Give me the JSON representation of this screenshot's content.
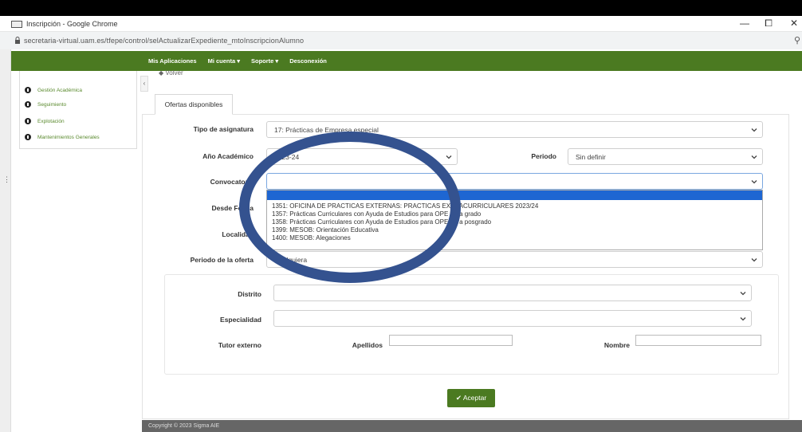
{
  "window": {
    "title": "Inscripción - Google Chrome",
    "controls": [
      "—",
      "⧠",
      "✕"
    ]
  },
  "browser": {
    "url": "secretaria-virtual.uam.es/tfepe/control/selActualizarExpediente_mtoInscripcionAlumno"
  },
  "navbar": {
    "items": [
      "Mis Aplicaciones",
      "Mi cuenta ▾",
      "Soporte ▾",
      "Desconexión"
    ]
  },
  "sidebar": {
    "items": [
      "Gestión Académica",
      "Seguimiento",
      "Explotación",
      "Mantenimientos Generales"
    ]
  },
  "page": {
    "volver": "Volver",
    "tab": "Ofertas disponibles"
  },
  "form": {
    "tipo_asignatura": {
      "label": "Tipo de asignatura",
      "value": "17: Prácticas de Empresa especial"
    },
    "anio": {
      "label": "Año Académico",
      "value": "2023-24"
    },
    "periodo": {
      "label": "Periodo",
      "value": "Sin definir"
    },
    "convocatoria": {
      "label": "Convocatoria",
      "value": ""
    },
    "desde_fecha": {
      "label": "Desde Fecha"
    },
    "localidad": {
      "label": "Localidad"
    },
    "periodo_oferta": {
      "label": "Periodo de la oferta",
      "value": "Cualquiera"
    },
    "distrito": {
      "label": "Distrito",
      "value": ""
    },
    "especialidad": {
      "label": "Especialidad",
      "value": ""
    },
    "tutor": {
      "label": "Tutor externo",
      "apellidos": "Apellidos",
      "nombre": "Nombre"
    }
  },
  "dropdown_options": [
    "1351: OFICINA DE PRACTICAS EXTERNAS: PRACTICAS EXTRACURRICULARES 2023/24",
    "1357: Prácticas Curriculares con Ayuda de Estudios para OPE para grado",
    "1358: Prácticas Curriculares con Ayuda de Estudios para OPE para posgrado",
    "1399: MESOB: Orientación Educativa",
    "1400: MESOB: Alegaciones"
  ],
  "buttons": {
    "aceptar": "✔ Aceptar"
  },
  "footer": {
    "copyright": "Copyright © 2023 Sigma AIE"
  },
  "colors": {
    "green": "#4b7a21",
    "highlight": "#1e66d2",
    "annotation": "#34528f"
  }
}
